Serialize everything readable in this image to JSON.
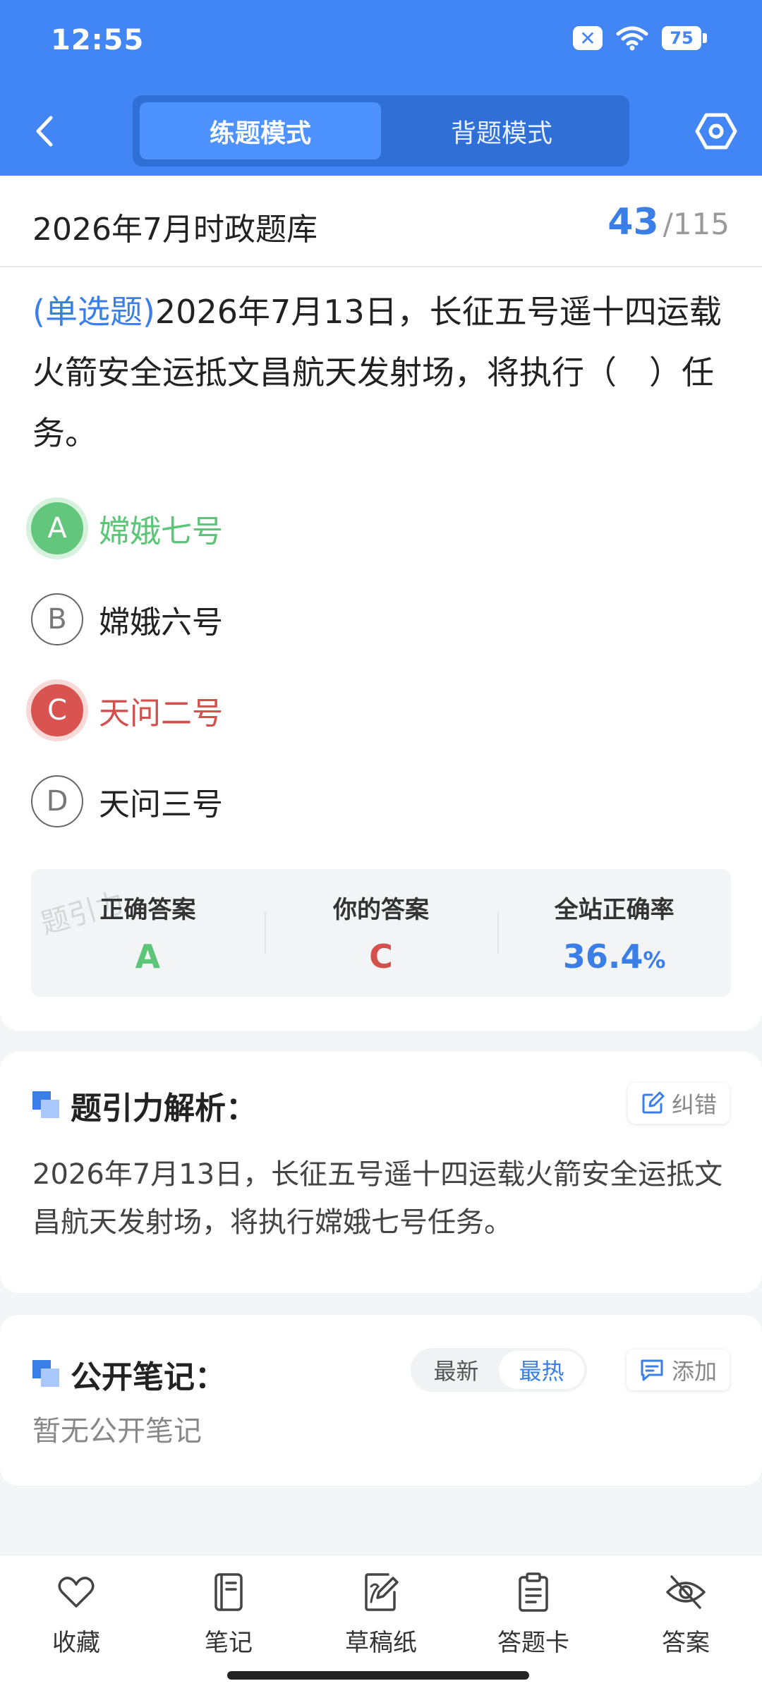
{
  "status_bar": {
    "time": "12:55",
    "battery": "75"
  },
  "header": {
    "tabs": [
      {
        "label": "练题模式",
        "active": true
      },
      {
        "label": "背题模式",
        "active": false
      }
    ]
  },
  "bank": {
    "title": "2026年7月时政题库",
    "current": "43",
    "separator": "/",
    "total": "115"
  },
  "question": {
    "type": "(单选题)",
    "text": "2026年7月13日，长征五号遥十四运载火箭安全运抵文昌航天发射场，将执行（　）任务。",
    "options": [
      {
        "letter": "A",
        "text": "嫦娥七号",
        "state": "correct"
      },
      {
        "letter": "B",
        "text": "嫦娥六号",
        "state": "normal"
      },
      {
        "letter": "C",
        "text": "天问二号",
        "state": "wrong"
      },
      {
        "letter": "D",
        "text": "天问三号",
        "state": "normal"
      }
    ]
  },
  "answer_summary": {
    "correct_label": "正确答案",
    "correct_value": "A",
    "yours_label": "你的答案",
    "yours_value": "C",
    "rate_label": "全站正确率",
    "rate_value": "36.4",
    "rate_unit": "%",
    "watermark": "题引力"
  },
  "analysis": {
    "title": "题引力解析：",
    "report_label": "纠错",
    "text": "2026年7月13日，长征五号遥十四运载火箭安全运抵文昌航天发射场，将执行嫦娥七号任务。"
  },
  "notes": {
    "title": "公开笔记：",
    "sort_options": [
      {
        "label": "最新",
        "active": false
      },
      {
        "label": "最热",
        "active": true
      }
    ],
    "add_label": "添加",
    "empty_text": "暂无公开笔记"
  },
  "bottom_nav": [
    {
      "label": "收藏",
      "icon": "heart-icon"
    },
    {
      "label": "笔记",
      "icon": "notebook-icon"
    },
    {
      "label": "草稿纸",
      "icon": "draft-paper-icon"
    },
    {
      "label": "答题卡",
      "icon": "clipboard-icon"
    },
    {
      "label": "答案",
      "icon": "eye-off-icon"
    }
  ],
  "colors": {
    "header_blue": "#4285f4",
    "accent_blue": "#3a7ee8",
    "correct_green": "#5cc577",
    "wrong_red": "#d3504c"
  }
}
